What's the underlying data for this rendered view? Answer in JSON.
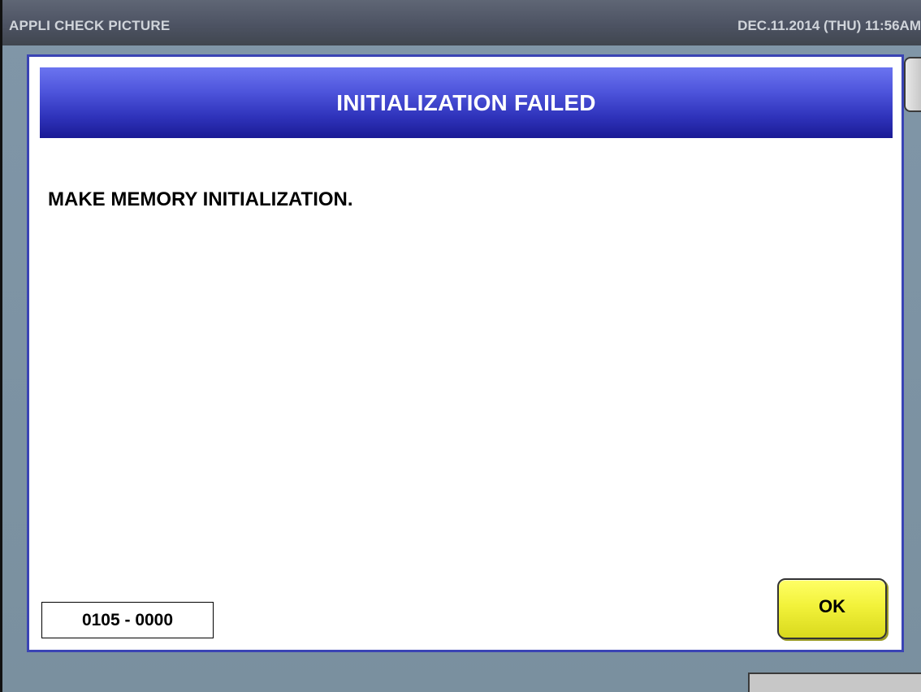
{
  "titlebar": {
    "app_title": "APPLI CHECK PICTURE",
    "datetime": "DEC.11.2014 (THU)  11:56AM"
  },
  "dialog": {
    "title": "INITIALIZATION FAILED",
    "message": "MAKE MEMORY INITIALIZATION.",
    "error_code": "0105 - 0000",
    "ok_label": "OK"
  },
  "colors": {
    "titlebar_bg": "#4d5363",
    "background": "#7a909f",
    "dialog_border": "#3a44b4",
    "header_gradient_top": "#6b74f0",
    "header_gradient_bottom": "#1a1a95",
    "ok_button": "#f2f23a"
  }
}
